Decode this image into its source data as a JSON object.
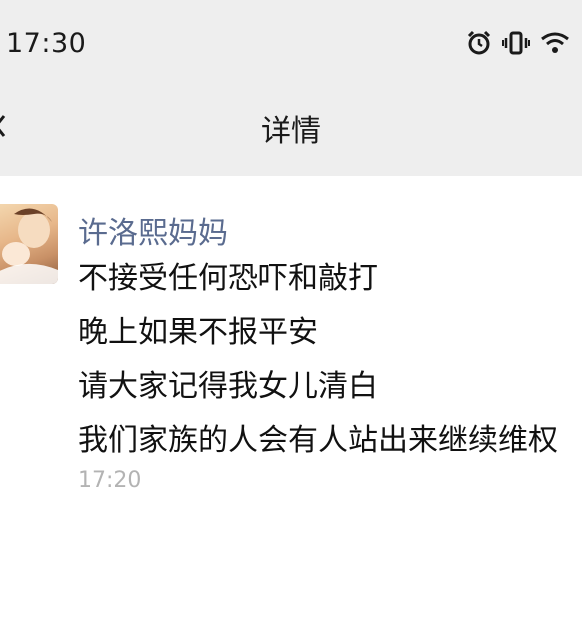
{
  "status_bar": {
    "time": "17:30",
    "icons": [
      "alarm-icon",
      "vibrate-icon",
      "wifi-icon"
    ]
  },
  "nav": {
    "title": "详情",
    "back_icon": "chevron-left-icon"
  },
  "message": {
    "sender": "许洛熙妈妈",
    "lines": [
      "不接受任何恐吓和敲打",
      "晚上如果不报平安",
      "请大家记得我女儿清白",
      "我们家族的人会有人站出来继续维权"
    ],
    "time": "17:20"
  },
  "colors": {
    "top_background": "#eeeeee",
    "sender_name": "#5a6b8f",
    "timestamp": "#b3b3b3"
  }
}
